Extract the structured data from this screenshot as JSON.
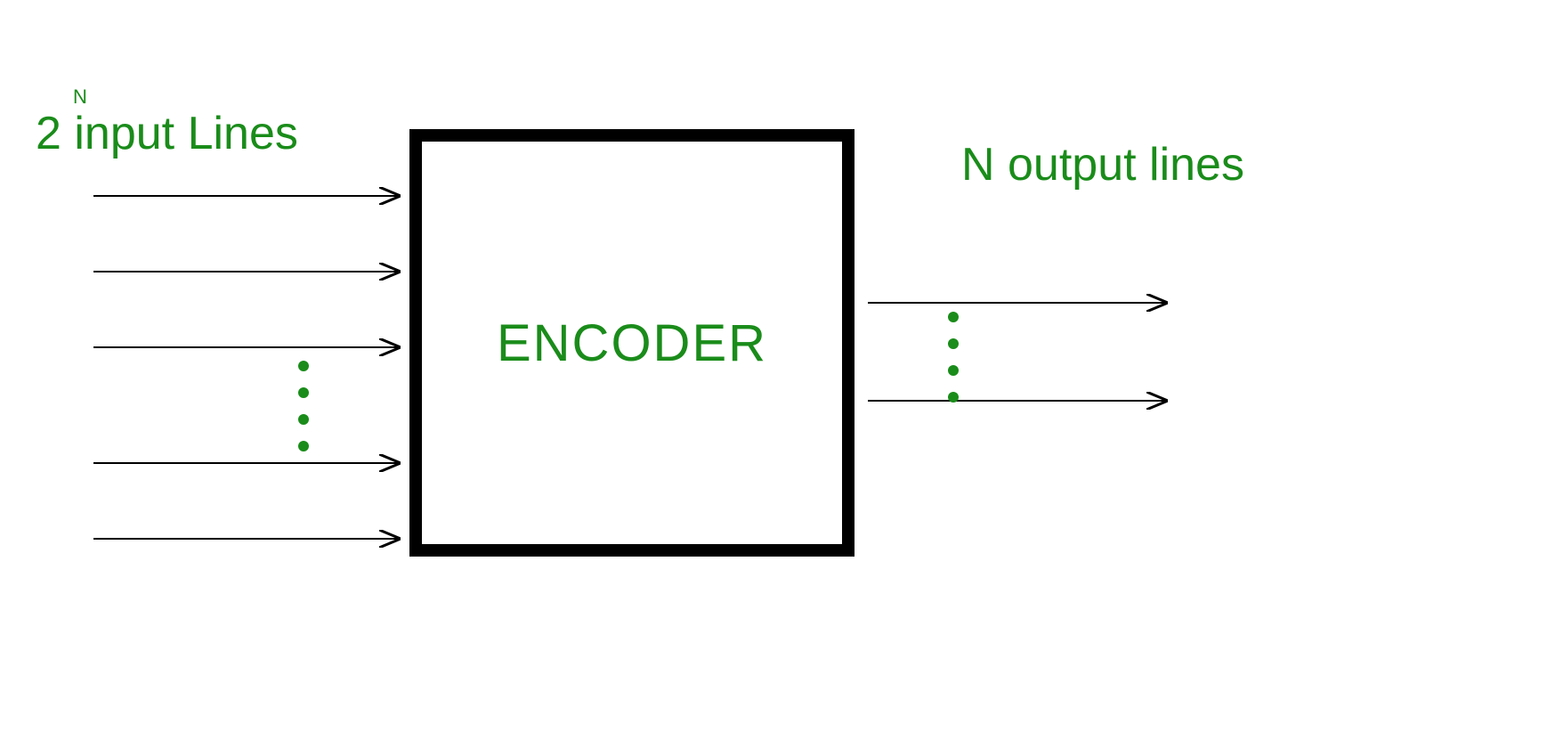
{
  "input_label": {
    "base": "2",
    "exponent": "N",
    "rest": " input Lines"
  },
  "output_label": "N output lines",
  "box_label": "ENCODER",
  "diagram": {
    "inputs_count": 5,
    "outputs_count": 2,
    "input_ellipsis_dots": 4,
    "output_ellipsis_dots": 4
  }
}
